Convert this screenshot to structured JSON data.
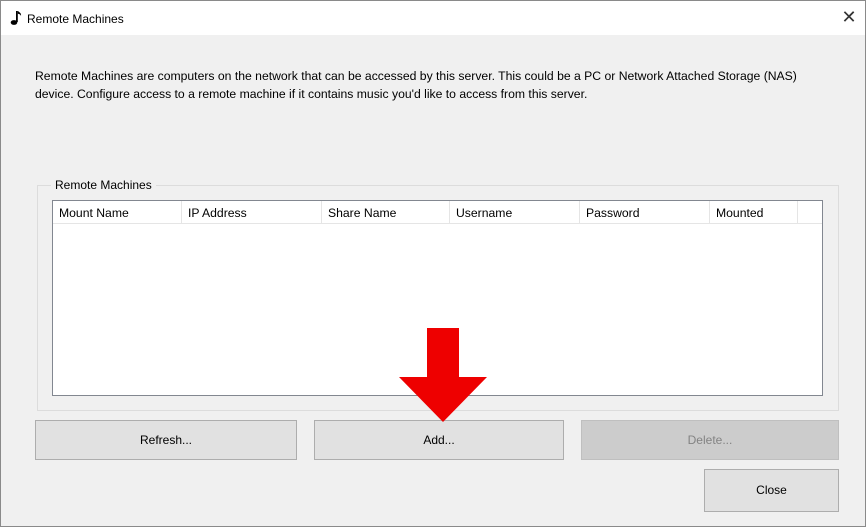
{
  "window": {
    "title": "Remote Machines",
    "close_glyph": "✕"
  },
  "description": "Remote Machines are computers on the network that can be accessed by this server. This could be a PC or Network Attached Storage (NAS) device. Configure access to a remote machine if it contains music you'd like to access from this server.",
  "group": {
    "label": "Remote Machines",
    "columns": [
      "Mount Name",
      "IP Address",
      "Share Name",
      "Username",
      "Password",
      "Mounted"
    ]
  },
  "buttons": {
    "refresh": "Refresh...",
    "add": "Add...",
    "delete": "Delete...",
    "close": "Close"
  },
  "annotation": {
    "arrow_color": "#ee0000",
    "arrow_icon": "down-arrow-icon"
  },
  "colors": {
    "window_bg": "#f0f0f0",
    "button_bg": "#e1e1e1",
    "button_disabled_bg": "#cccccc"
  }
}
